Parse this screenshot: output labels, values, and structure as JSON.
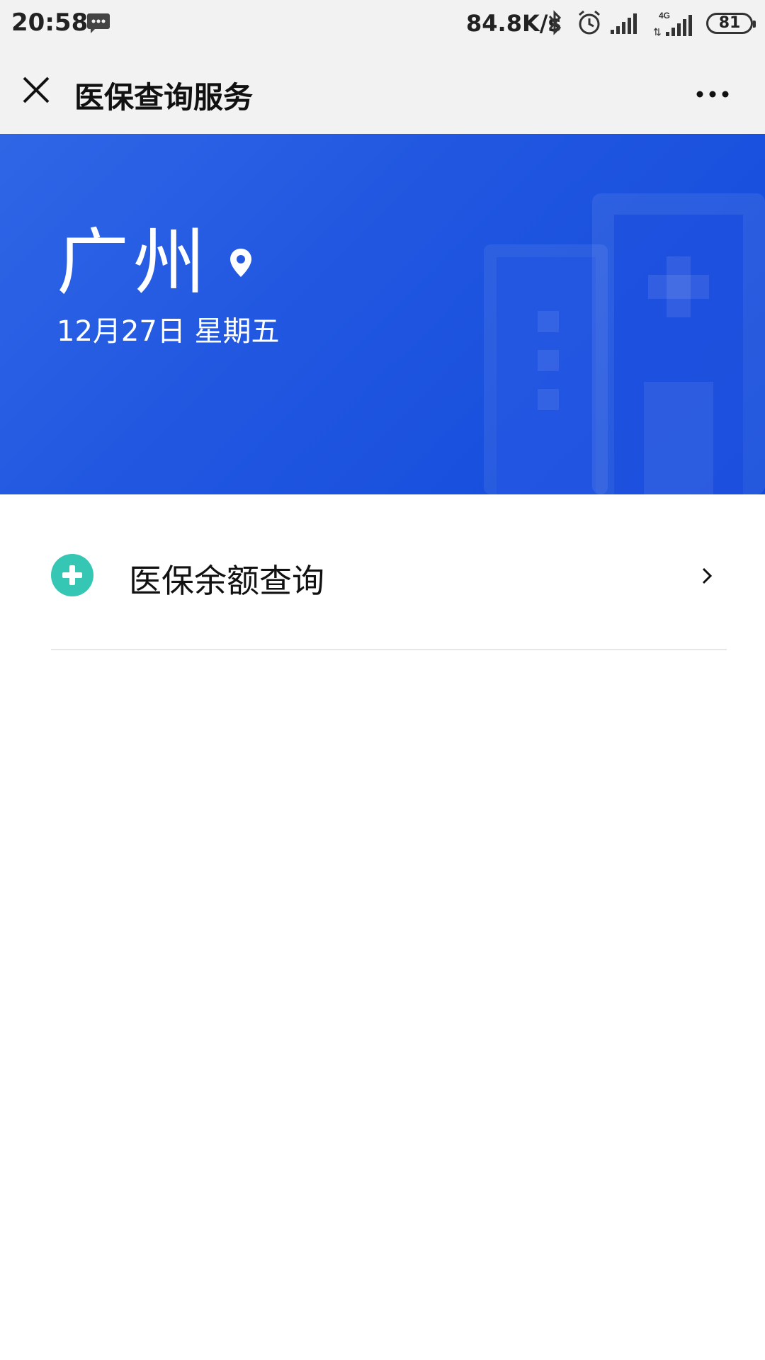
{
  "status_bar": {
    "time": "20:58",
    "net_speed": "84.8K/s",
    "network_label": "4G",
    "battery": "81",
    "icons": [
      "message-icon",
      "bluetooth-icon",
      "alarm-icon",
      "signal-icon",
      "signal-4g-icon",
      "battery-icon"
    ]
  },
  "nav": {
    "title": "医保查询服务",
    "close_icon": "close-icon",
    "more_icon": "more-icon"
  },
  "banner": {
    "city": "广州",
    "date": "12月27日 星期五",
    "location_icon": "location-pin-icon",
    "decoration_icon": "hospital-building-icon",
    "gradient_start": "#2f66e6",
    "gradient_end": "#124adb"
  },
  "menu": {
    "items": [
      {
        "label": "医保余额查询",
        "icon": "medical-plus-icon",
        "icon_color": "#35c7b4"
      }
    ]
  }
}
